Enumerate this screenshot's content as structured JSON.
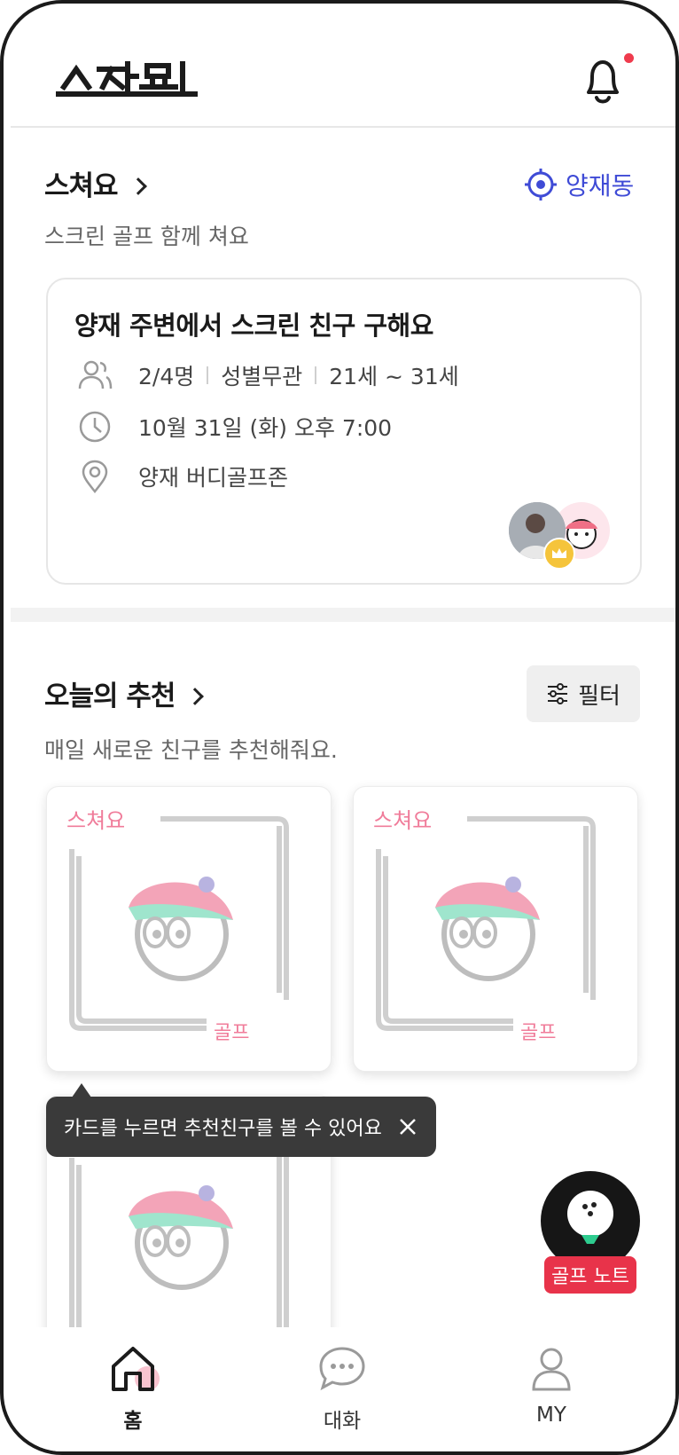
{
  "header": {
    "logo_text": "스쳐요",
    "notification_dot_color": "#ef3b4d"
  },
  "section1": {
    "title": "스쳐요",
    "subtitle": "스크린 골프 함께 쳐요",
    "location": "양재동",
    "accent_color": "#3f4bd6",
    "card": {
      "title": "양재 주변에서 스크린 친구 구해요",
      "members": "2/4명",
      "gender": "성별무관",
      "age": "21세 ~ 31세",
      "datetime": "10월 31일 (화) 오후 7:00",
      "place": "양재 버디골프존"
    }
  },
  "section2": {
    "title": "오늘의 추천",
    "subtitle": "매일 새로운 친구를 추천해줘요.",
    "filter_label": "필터",
    "tooltip": "카드를 누르면 추천친구를 볼 수 있어요"
  },
  "fab": {
    "label": "골프 노트",
    "color": "#e8334a"
  },
  "tabs": [
    {
      "label": "홈",
      "icon": "home-icon"
    },
    {
      "label": "대화",
      "icon": "chat-icon"
    },
    {
      "label": "MY",
      "icon": "user-icon"
    }
  ]
}
